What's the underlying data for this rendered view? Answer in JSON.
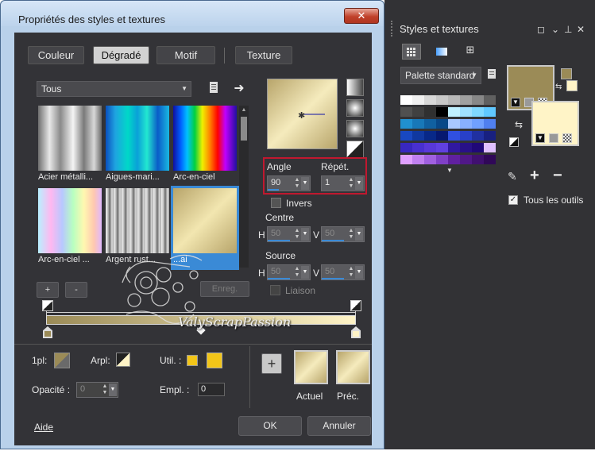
{
  "dialog": {
    "title": "Propriétés des styles et textures",
    "close": "✕"
  },
  "tabs": [
    {
      "label": "Couleur"
    },
    {
      "label": "Dégradé"
    },
    {
      "label": "Motif"
    },
    {
      "label": "Texture"
    }
  ],
  "preset_filter": {
    "value": "Tous"
  },
  "presets": [
    {
      "label": "Acier métalli..."
    },
    {
      "label": "Aigues-mari..."
    },
    {
      "label": "Arc-en-ciel"
    },
    {
      "label": "Arc-en-ciel ..."
    },
    {
      "label": "Argent rust..."
    },
    {
      "label": "...ai"
    }
  ],
  "buttons": {
    "add": "+",
    "remove": "-",
    "save": "Enreg.",
    "help": "Aide",
    "ok": "OK",
    "cancel": "Annuler"
  },
  "angle": {
    "label": "Angle",
    "value": "90"
  },
  "repeat": {
    "label": "Répét.",
    "value": "1"
  },
  "invert": {
    "label": "Invers"
  },
  "center": {
    "label": "Centre",
    "h_label": "H",
    "h_value": "50",
    "v_label": "V",
    "v_value": "50"
  },
  "source": {
    "label": "Source",
    "h_label": "H",
    "h_value": "50",
    "v_label": "V",
    "v_value": "50"
  },
  "link": {
    "label": "Liaison"
  },
  "bottom": {
    "first_plan_label": "1pl:",
    "back_plan_label": "Arpl:",
    "used_label": "Util. :",
    "opacity_label": "Opacité :",
    "opacity_value": "0",
    "location_label": "Empl. :",
    "location_value": "0",
    "current_label": "Actuel",
    "previous_label": "Préc."
  },
  "dock": {
    "title": "Styles et textures",
    "palette": "Palette standard",
    "all_tools": "Tous les outils",
    "plus": "+",
    "minus": "−"
  },
  "watermark": "ValyScrapPassion",
  "colors": {
    "gold": "#9b8b57",
    "cream": "#fff4c7",
    "accent_blue": "#3a8ad6",
    "highlight_red": "#c0182f",
    "util_yellow": "#f2c518"
  }
}
